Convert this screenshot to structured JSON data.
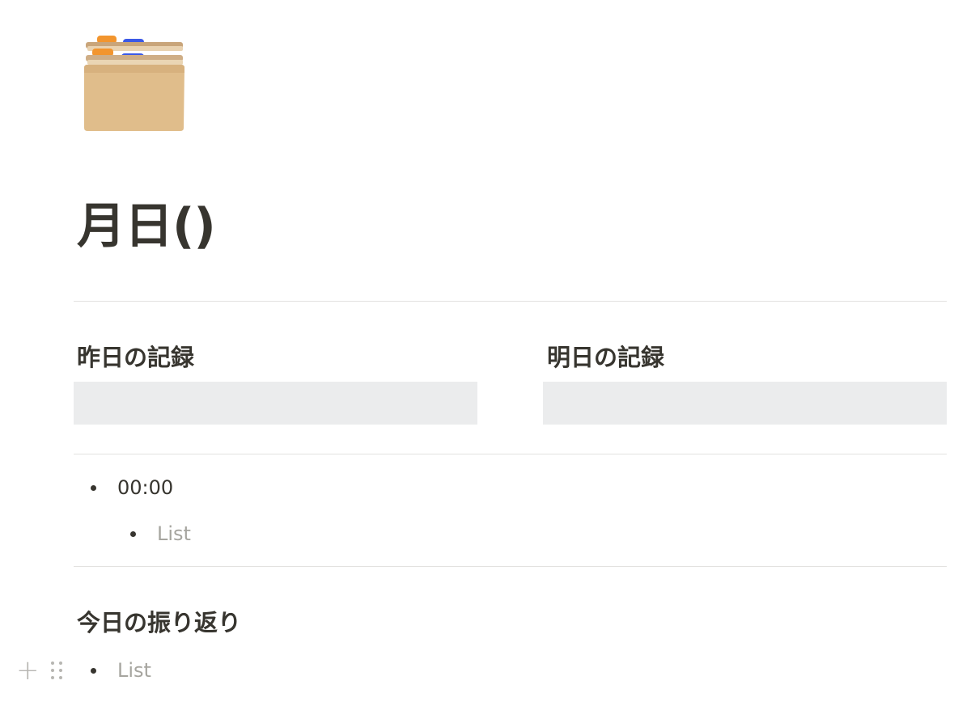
{
  "page": {
    "icon": "card-file-box-icon",
    "title": "月日()"
  },
  "columns": [
    {
      "heading": "昨日の記録"
    },
    {
      "heading": "明日の記録"
    }
  ],
  "timeline": {
    "time": "00:00",
    "sub_item_placeholder": "List"
  },
  "reflection": {
    "heading": "今日の振り返り",
    "item_placeholder": "List"
  },
  "controls": {
    "add_block_icon": "plus-icon",
    "drag_handle_icon": "drag-handle-icon"
  },
  "colors": {
    "text": "#37352f",
    "placeholder": "#a6a59f",
    "divider": "#e3e2e0",
    "embed_background": "#ebeced"
  }
}
